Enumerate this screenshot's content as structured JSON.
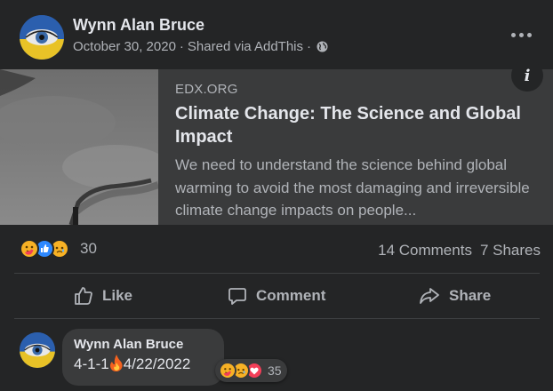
{
  "post": {
    "author": "Wynn Alan Bruce",
    "date": "October 30, 2020",
    "separator": "·",
    "shared_via": "Shared via AddThis",
    "separator2": "·",
    "privacy_icon": "globe-icon",
    "menu_icon": "more-options-icon"
  },
  "link_preview": {
    "domain": "EDX.ORG",
    "title": "Climate Change: The Science and Global Impact",
    "description": "We need to understand the science behind global warming to avoid the most damaging and irreversible climate change impacts on people...",
    "info_icon_label": "i"
  },
  "reactions": {
    "icons": [
      "care-reaction-icon",
      "like-reaction-icon",
      "sad-reaction-icon"
    ],
    "count": "30",
    "comments": "14 Comments",
    "shares": "7 Shares"
  },
  "actions": {
    "like": "Like",
    "comment": "Comment",
    "share": "Share"
  },
  "comment": {
    "author": "Wynn Alan Bruce",
    "text_before_emoji": "4-1-1",
    "emoji": "fire-emoji",
    "text_after_emoji": "4/22/2022",
    "reaction_icons": [
      "care-reaction-icon",
      "sad-reaction-icon",
      "love-reaction-icon"
    ],
    "reaction_count": "35"
  },
  "colors": {
    "card_bg": "#242526",
    "preview_bg": "#3a3b3c",
    "text_primary": "#e4e6eb",
    "text_secondary": "#b0b3b8",
    "like_blue": "#2d88ff",
    "love_red": "#f33e58",
    "emoji_yellow": "#f7b125"
  }
}
